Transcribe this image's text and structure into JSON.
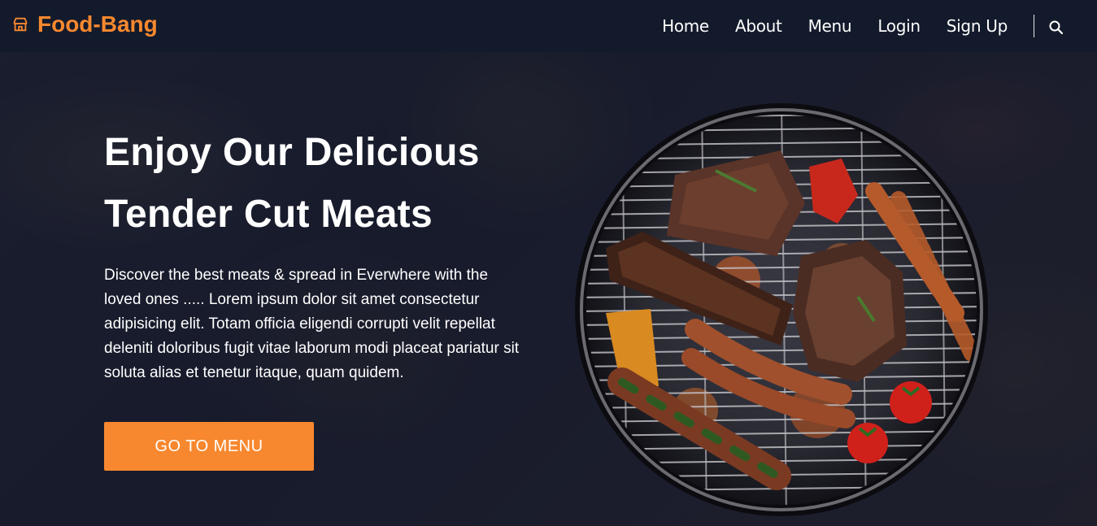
{
  "brand": {
    "name": "Food-Bang",
    "icon": "store-icon",
    "color": "#f7882f"
  },
  "nav": {
    "items": [
      {
        "label": "Home"
      },
      {
        "label": "About"
      },
      {
        "label": "Menu"
      },
      {
        "label": "Login"
      },
      {
        "label": "Sign Up"
      }
    ],
    "search_icon": "search-icon"
  },
  "hero": {
    "headline_line1": "Enjoy Our Delicious",
    "headline_line2": "Tender Cut Meats",
    "description": "Discover the best meats & spread in Everwhere with the loved ones ..... Lorem ipsum dolor sit amet consectetur adipisicing elit. Totam officia eligendi corrupti velit repellat deleniti doloribus fugit vitae laborum modi placeat pariatur sit soluta alias et tenetur itaque, quam quidem.",
    "cta_label": "GO TO MENU",
    "image": "grill-image"
  },
  "colors": {
    "accent": "#f7882f",
    "navbar_bg": "#131a2b",
    "text": "#ffffff"
  }
}
